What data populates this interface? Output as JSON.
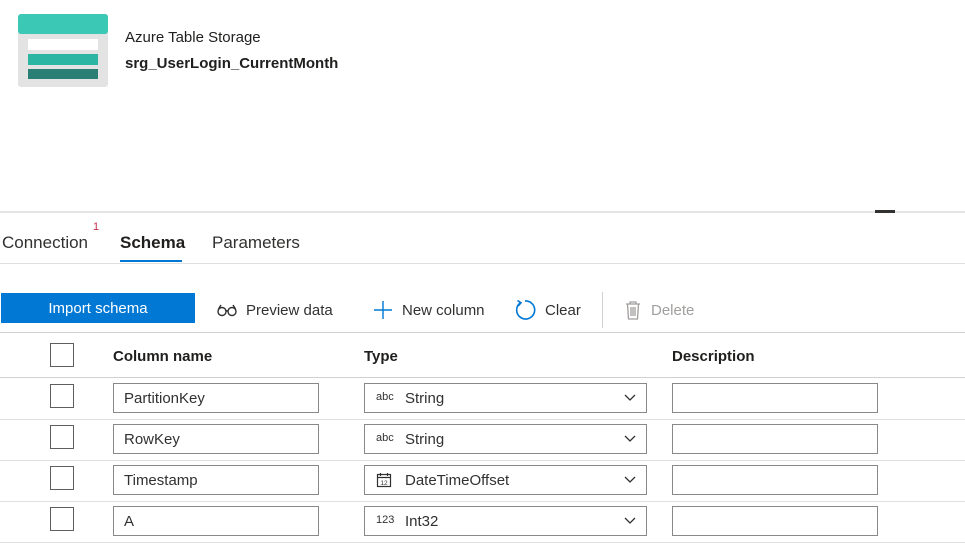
{
  "dataset": {
    "kind": "Azure Table Storage",
    "name": "srg_UserLogin_CurrentMonth",
    "icon": "azure-table-storage-icon"
  },
  "tabs": [
    {
      "label": "Connection",
      "badge": "1"
    },
    {
      "label": "Schema",
      "active": true
    },
    {
      "label": "Parameters"
    }
  ],
  "toolbar": {
    "import_schema": "Import schema",
    "preview_data": "Preview data",
    "new_column": "New column",
    "clear": "Clear",
    "delete": "Delete"
  },
  "table": {
    "headers": {
      "name": "Column name",
      "type": "Type",
      "description": "Description"
    },
    "rows": [
      {
        "name": "PartitionKey",
        "type_icon": "abc",
        "type": "String",
        "description": ""
      },
      {
        "name": "RowKey",
        "type_icon": "abc",
        "type": "String",
        "description": ""
      },
      {
        "name": "Timestamp",
        "type_icon": "12",
        "type": "DateTimeOffset",
        "description": ""
      },
      {
        "name": "A",
        "type_icon": "123",
        "type": "Int32",
        "description": ""
      }
    ]
  },
  "colors": {
    "accent": "#0078d4",
    "icon_teal": "#3bc8b4",
    "icon_teal_mid": "#2db5a3",
    "icon_teal_dark": "#2a7f74",
    "badge": "#c4314b"
  }
}
